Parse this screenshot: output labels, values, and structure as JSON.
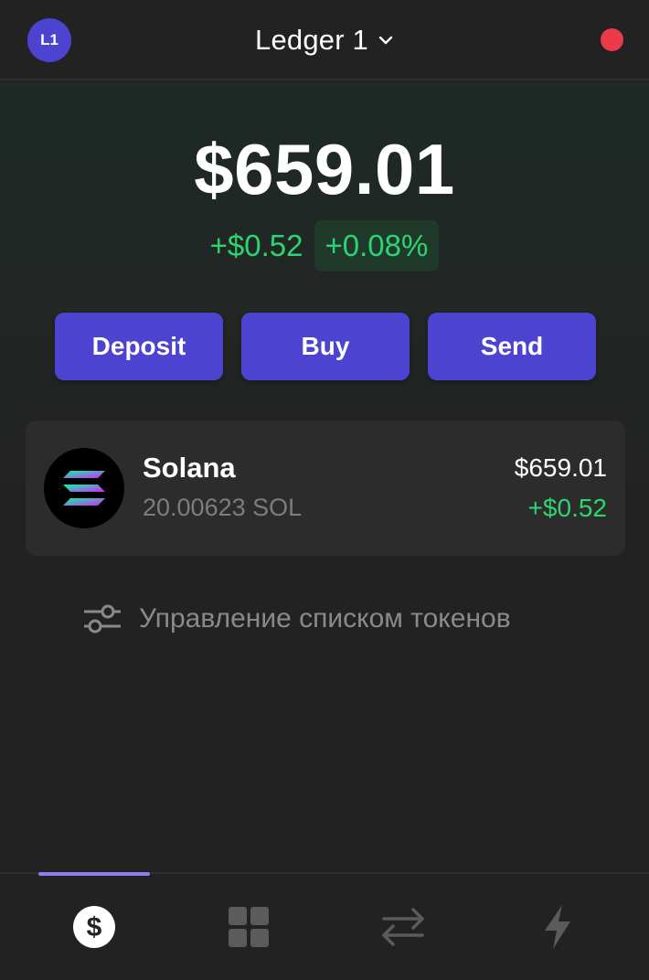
{
  "header": {
    "avatar_initials": "L1",
    "wallet_name": "Ledger 1",
    "status_color": "#eb3b48"
  },
  "portfolio": {
    "balance": "$659.01",
    "change_abs": "+$0.52",
    "change_pct": "+0.08%"
  },
  "actions": {
    "deposit": "Deposit",
    "buy": "Buy",
    "send": "Send"
  },
  "tokens": [
    {
      "name": "Solana",
      "amount": "20.00623 SOL",
      "value": "$659.01",
      "change": "+$0.52",
      "icon": "solana-logo-icon"
    }
  ],
  "manage_tokens": {
    "label": "Управление списком токенов",
    "icon": "sliders-icon"
  },
  "tabbar": {
    "items": [
      {
        "icon": "dollar-icon",
        "active": true
      },
      {
        "icon": "grid-icon",
        "active": false
      },
      {
        "icon": "swap-icon",
        "active": false
      },
      {
        "icon": "lightning-icon",
        "active": false
      }
    ],
    "active_color": "#8f7cf0"
  },
  "colors": {
    "accent": "#4c43d0",
    "positive": "#2ed372",
    "background": "#222222"
  }
}
